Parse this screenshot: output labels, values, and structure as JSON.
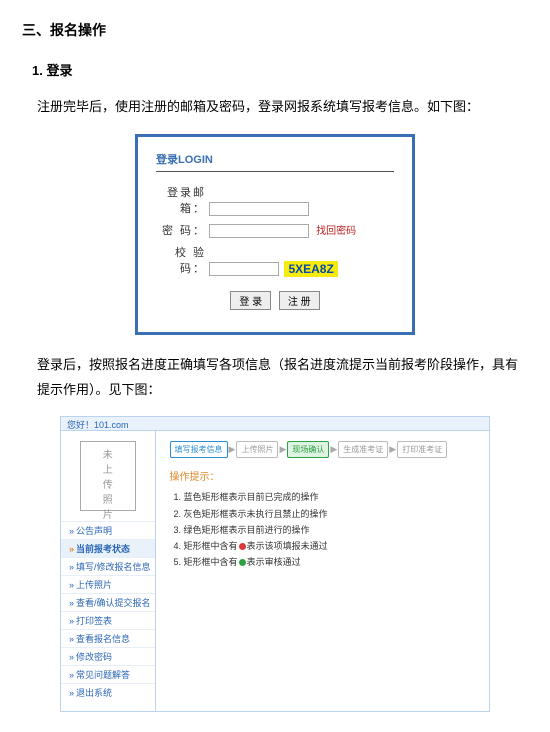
{
  "section_title": "三、报名操作",
  "sub_title": "1.  登录",
  "para1": "注册完毕后，使用注册的邮箱及密码，登录网报系统填写报考信息。如下图：",
  "para2": "登录后，按照报名进度正确填写各项信息（报名进度流提示当前报考阶段操作，具有提示作用）。见下图：",
  "login": {
    "title": "登录LOGIN",
    "email_label": "登录邮箱：",
    "password_label": "密    码：",
    "forgot": "找回密码",
    "captcha_label": "校 验 码：",
    "captcha_value": "5XEA8Z",
    "btn_login": "登 录",
    "btn_register": "注 册"
  },
  "progress": {
    "topbar": "您好！101.com",
    "photo_lines": [
      "未",
      "上",
      "传",
      "照",
      "片"
    ],
    "nav": [
      {
        "label": "公告声明",
        "hl": false
      },
      {
        "label": "当前报考状态",
        "hl": true
      },
      {
        "label": "填写/修改报名信息",
        "hl": false
      },
      {
        "label": "上传照片",
        "hl": false
      },
      {
        "label": "查看/确认提交报名",
        "hl": false
      },
      {
        "label": "打印签表",
        "hl": false
      },
      {
        "label": "查看报名信息",
        "hl": false
      },
      {
        "label": "修改密码",
        "hl": false
      },
      {
        "label": "常见问题解答",
        "hl": false
      },
      {
        "label": "退出系统",
        "hl": false
      }
    ],
    "steps": [
      {
        "label": "填写报考信息",
        "kind": "done"
      },
      {
        "label": "上传照片",
        "kind": "grey"
      },
      {
        "label": "现场确认",
        "kind": "active"
      },
      {
        "label": "生成准考证",
        "kind": "grey"
      },
      {
        "label": "打印准考证",
        "kind": "grey"
      }
    ],
    "tips_title": "操作提示：",
    "tips": [
      "蓝色矩形框表示目前已完成的操作",
      "灰色矩形框表示未执行且禁止的操作",
      "绿色矩形框表示目前进行的操作",
      "矩形框中含有●表示该项填报未通过",
      "矩形框中含有●表示审核通过"
    ]
  }
}
